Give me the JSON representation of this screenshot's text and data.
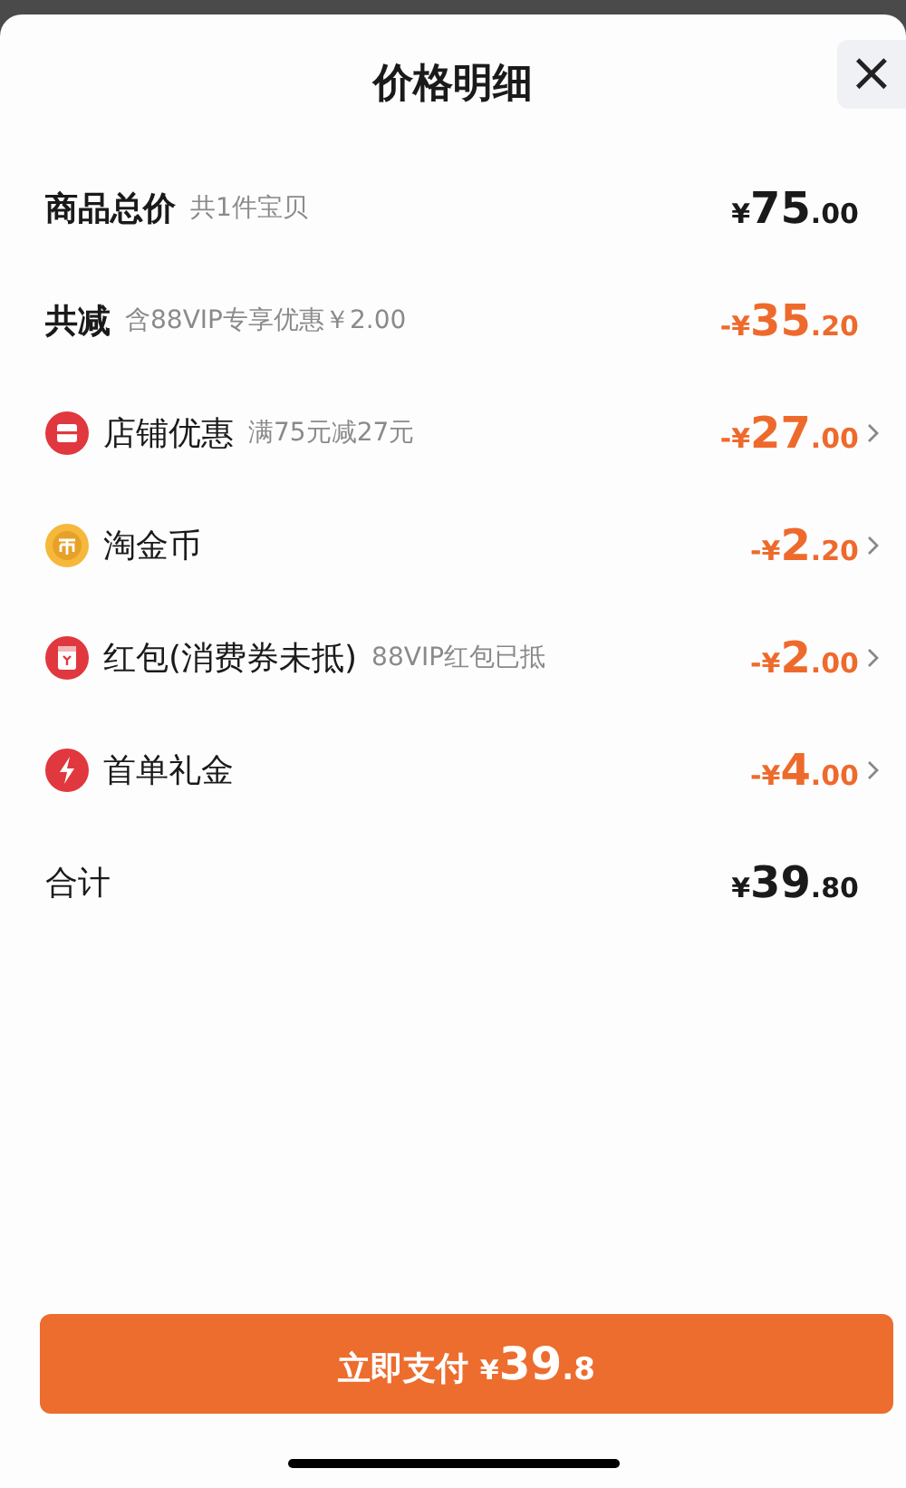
{
  "title": "价格明细",
  "close": {
    "label": "×"
  },
  "rows": [
    {
      "kind": "total",
      "label": "商品总价",
      "note": "共1件宝贝",
      "price": {
        "prefix": "¥",
        "main": "75",
        "cents": ".00"
      },
      "color": "#1a1a1a",
      "arrow": false
    },
    {
      "kind": "total",
      "label": "共减",
      "note": "含88VIP专享优惠￥2.00",
      "price": {
        "prefix": "-¥",
        "main": "35",
        "cents": ".20"
      },
      "color": "#ee6a2c",
      "arrow": false
    },
    {
      "kind": "shop",
      "label": "店铺优惠",
      "note": "满75元减27元",
      "price": {
        "prefix": "-¥",
        "main": "27",
        "cents": ".00"
      },
      "color": "#ee6a2c",
      "arrow": true
    },
    {
      "kind": "coin",
      "label": "淘金币",
      "price": {
        "prefix": "-¥",
        "main": "2",
        "cents": ".20"
      },
      "color": "#ee6a2c",
      "arrow": true
    },
    {
      "kind": "packet",
      "label": "红包(消费券未抵)",
      "note": "88VIP红包已抵",
      "price": {
        "prefix": "-¥",
        "main": "2",
        "cents": ".00"
      },
      "color": "#ee6a2c",
      "arrow": true
    },
    {
      "kind": "bolt",
      "label": "首单礼金",
      "price": {
        "prefix": "-¥",
        "main": "4",
        "cents": ".00"
      },
      "color": "#ee6a2c",
      "arrow": true
    },
    {
      "kind": "sum",
      "label": "合计",
      "price": {
        "prefix": "¥",
        "main": "39",
        "cents": ".80"
      },
      "color": "#1a1a1a",
      "arrow": false
    }
  ],
  "pay_button": {
    "label": "立即支付",
    "prefix": "¥",
    "main": "39",
    "cents": ".8"
  }
}
